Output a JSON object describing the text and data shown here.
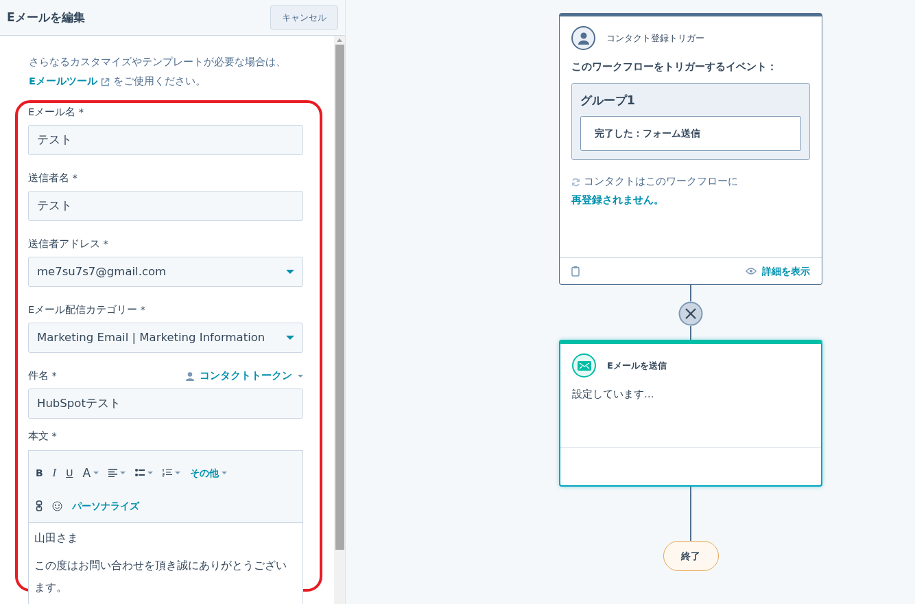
{
  "panel": {
    "title": "Eメールを編集",
    "cancel_button": "キャンセル",
    "intro": "さらなるカスタマイズやテンプレートが必要な場合は、",
    "intro_link": "Eメールツール",
    "intro_end": "をご使用ください。",
    "fields": [
      {
        "kind": "text",
        "label": "Eメール名 *",
        "value": "テスト"
      },
      {
        "kind": "text",
        "label": "送信者名 *",
        "value": "テスト"
      },
      {
        "kind": "select",
        "label": "送信者アドレス *",
        "value": "me7su7s7@gmail.com"
      },
      {
        "kind": "select",
        "label": "Eメール配信カテゴリー *",
        "value": "Marketing Email | Marketing Information"
      },
      {
        "kind": "text",
        "label": "件名 *",
        "value": "HubSpotテスト",
        "token_link": "コンタクトトークン"
      }
    ],
    "body": {
      "label": "本文 *",
      "toolbar_row1": [
        {
          "kind": "bold",
          "label": "B"
        },
        {
          "kind": "italic",
          "label": "I"
        },
        {
          "kind": "underline",
          "label": "U"
        },
        {
          "kind": "color",
          "label": "A"
        },
        {
          "kind": "align"
        },
        {
          "kind": "bullets"
        },
        {
          "kind": "numbers"
        },
        {
          "kind": "menu",
          "label": "その他"
        }
      ],
      "toolbar_row2": [
        {
          "kind": "link"
        },
        {
          "kind": "emoji"
        },
        {
          "kind": "personalize",
          "label": "パーソナライズ"
        }
      ],
      "paragraphs": [
        "山田さま",
        "この度はお問い合わせを頂き誠にありがとうございます。"
      ]
    }
  },
  "workflow": {
    "trigger": {
      "title": "コンタクト登録トリガー",
      "heading": "このワークフローをトリガーするイベント：",
      "group_title": "グループ1",
      "criteria": "完了した：フォーム送信",
      "reenroll_text": "コンタクトはこのワークフローに",
      "reenroll_link": "再登録されません。",
      "details_link": "詳細を表示"
    },
    "action": {
      "title": "Eメールを送信",
      "status": "設定しています…",
      "selected": true
    },
    "end": "終了"
  }
}
